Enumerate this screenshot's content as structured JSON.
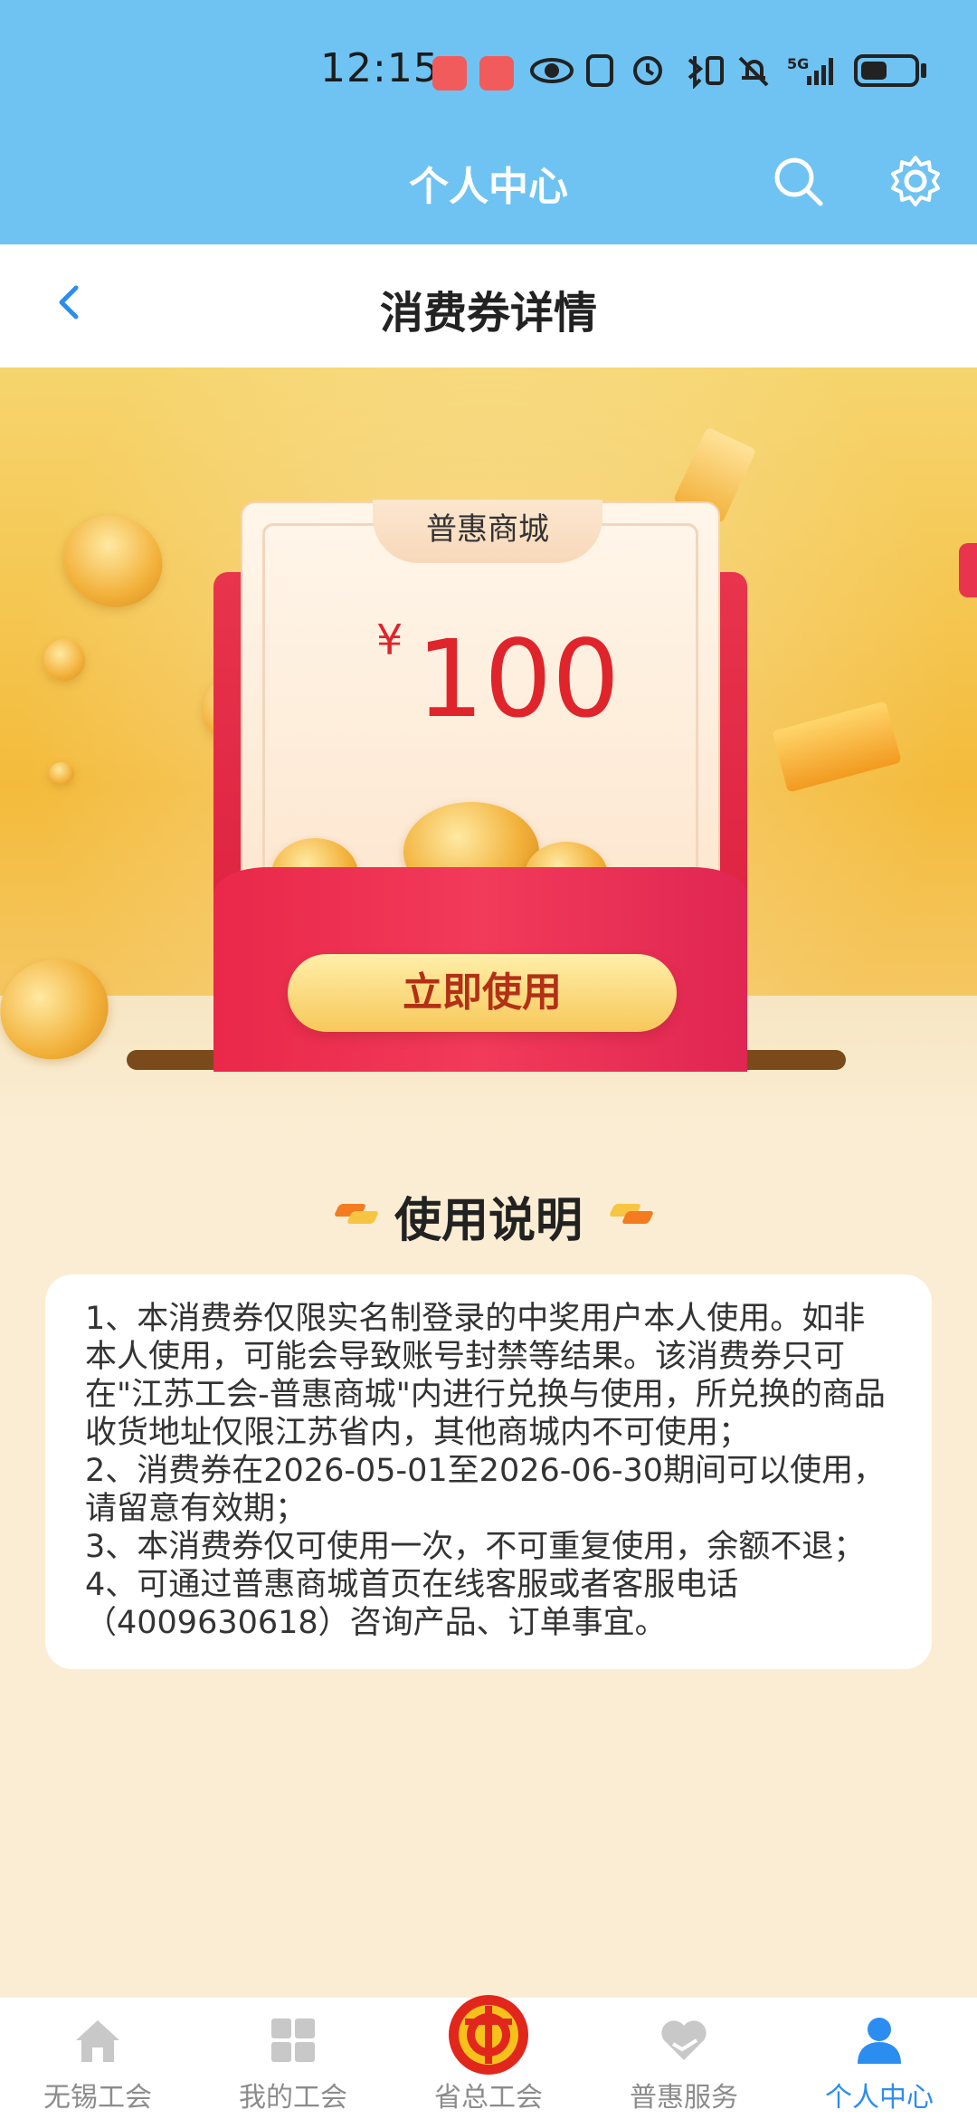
{
  "status_bar": {
    "time": "12:15",
    "network": "5G",
    "icons": [
      "eye-icon",
      "nfc-icon",
      "alarm-icon",
      "bluetooth-icon",
      "bell-off-icon",
      "signal-icon",
      "battery-icon"
    ]
  },
  "header": {
    "title": "个人中心"
  },
  "sub_header": {
    "title": "消费券详情"
  },
  "coupon": {
    "shop": "普惠商城",
    "currency": "¥",
    "amount": "100",
    "use_button": "立即使用"
  },
  "instructions": {
    "title": "使用说明",
    "lines": [
      "1、本消费券仅限实名制登录的中奖用户本人使用。如非本人使用，可能会导致账号封禁等结果。该消费券只可在\"江苏工会-普惠商城\"内进行兑换与使用，所兑换的商品收货地址仅限江苏省内，其他商城内不可使用；",
      "2、消费券在2026-05-01至2026-06-30期间可以使用，请留意有效期；",
      "3、本消费券仅可使用一次，不可重复使用，余额不退；",
      "4、可通过普惠商城首页在线客服或者客服电话（4009630618）咨询产品、订单事宜。"
    ]
  },
  "bottom_nav": {
    "items": [
      {
        "label": "无锡工会",
        "icon": "home-icon"
      },
      {
        "label": "我的工会",
        "icon": "grid-icon"
      },
      {
        "label": "省总工会",
        "icon": "union-emblem-icon"
      },
      {
        "label": "普惠服务",
        "icon": "heart-hand-icon"
      },
      {
        "label": "个人中心",
        "icon": "person-icon"
      }
    ],
    "active": "个人中心"
  },
  "colors": {
    "header_bg": "#6ec3f3",
    "active_nav": "#2c8df0",
    "coupon_red": "#e0242c"
  }
}
